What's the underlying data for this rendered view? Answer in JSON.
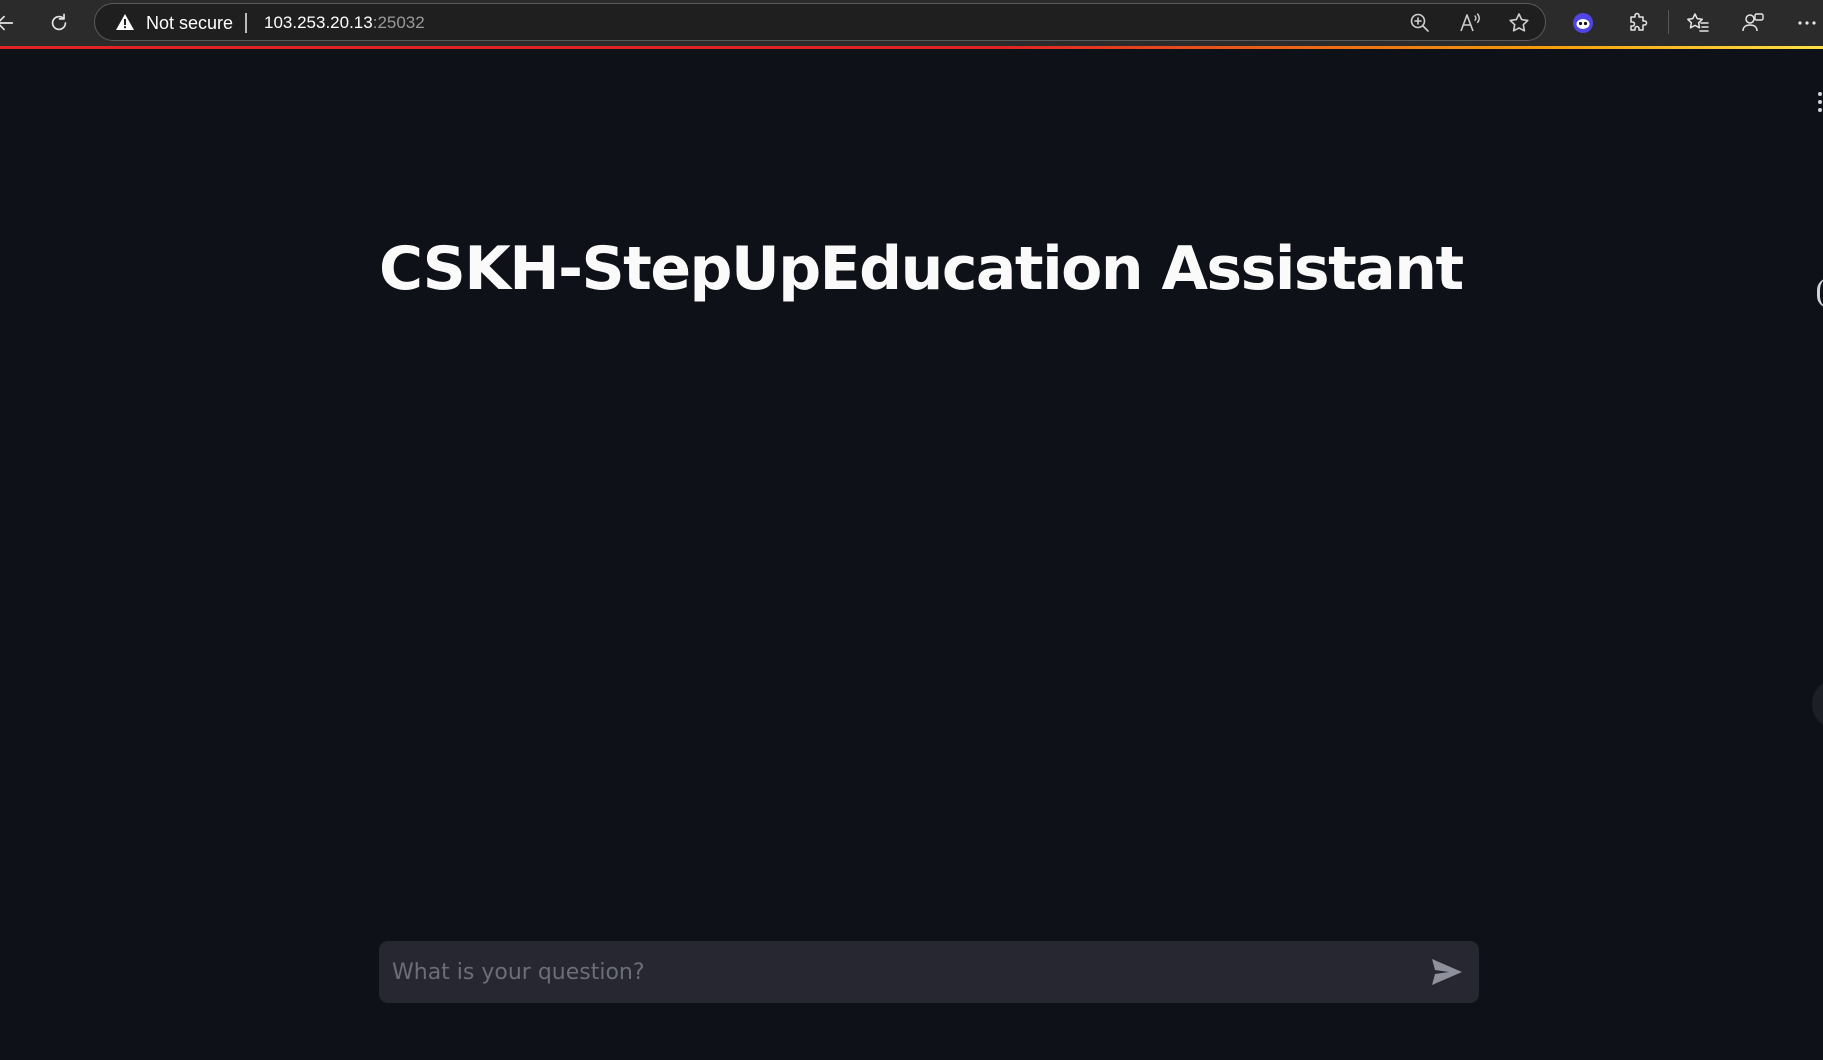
{
  "browser": {
    "security_label": "Not secure",
    "url_host": "103.253.20.13",
    "url_port": ":25032",
    "icons": [
      "back-icon",
      "refresh-icon",
      "warning-icon",
      "zoom-icon",
      "read-aloud-icon",
      "favorite-star-icon",
      "extension-face-icon",
      "extensions-puzzle-icon",
      "favorites-icon",
      "profile-icon",
      "more-icon"
    ]
  },
  "page": {
    "title": "CSKH-StepUpEducation Assistant"
  },
  "chat": {
    "placeholder": "What is your question?",
    "value": ""
  },
  "colors": {
    "background": "#0e1117",
    "browser_chrome": "#2b2b2b",
    "input_background": "#262730",
    "accent_line_start": "#e02424",
    "accent_line_end": "#fde047",
    "title_text": "#fafafa"
  }
}
